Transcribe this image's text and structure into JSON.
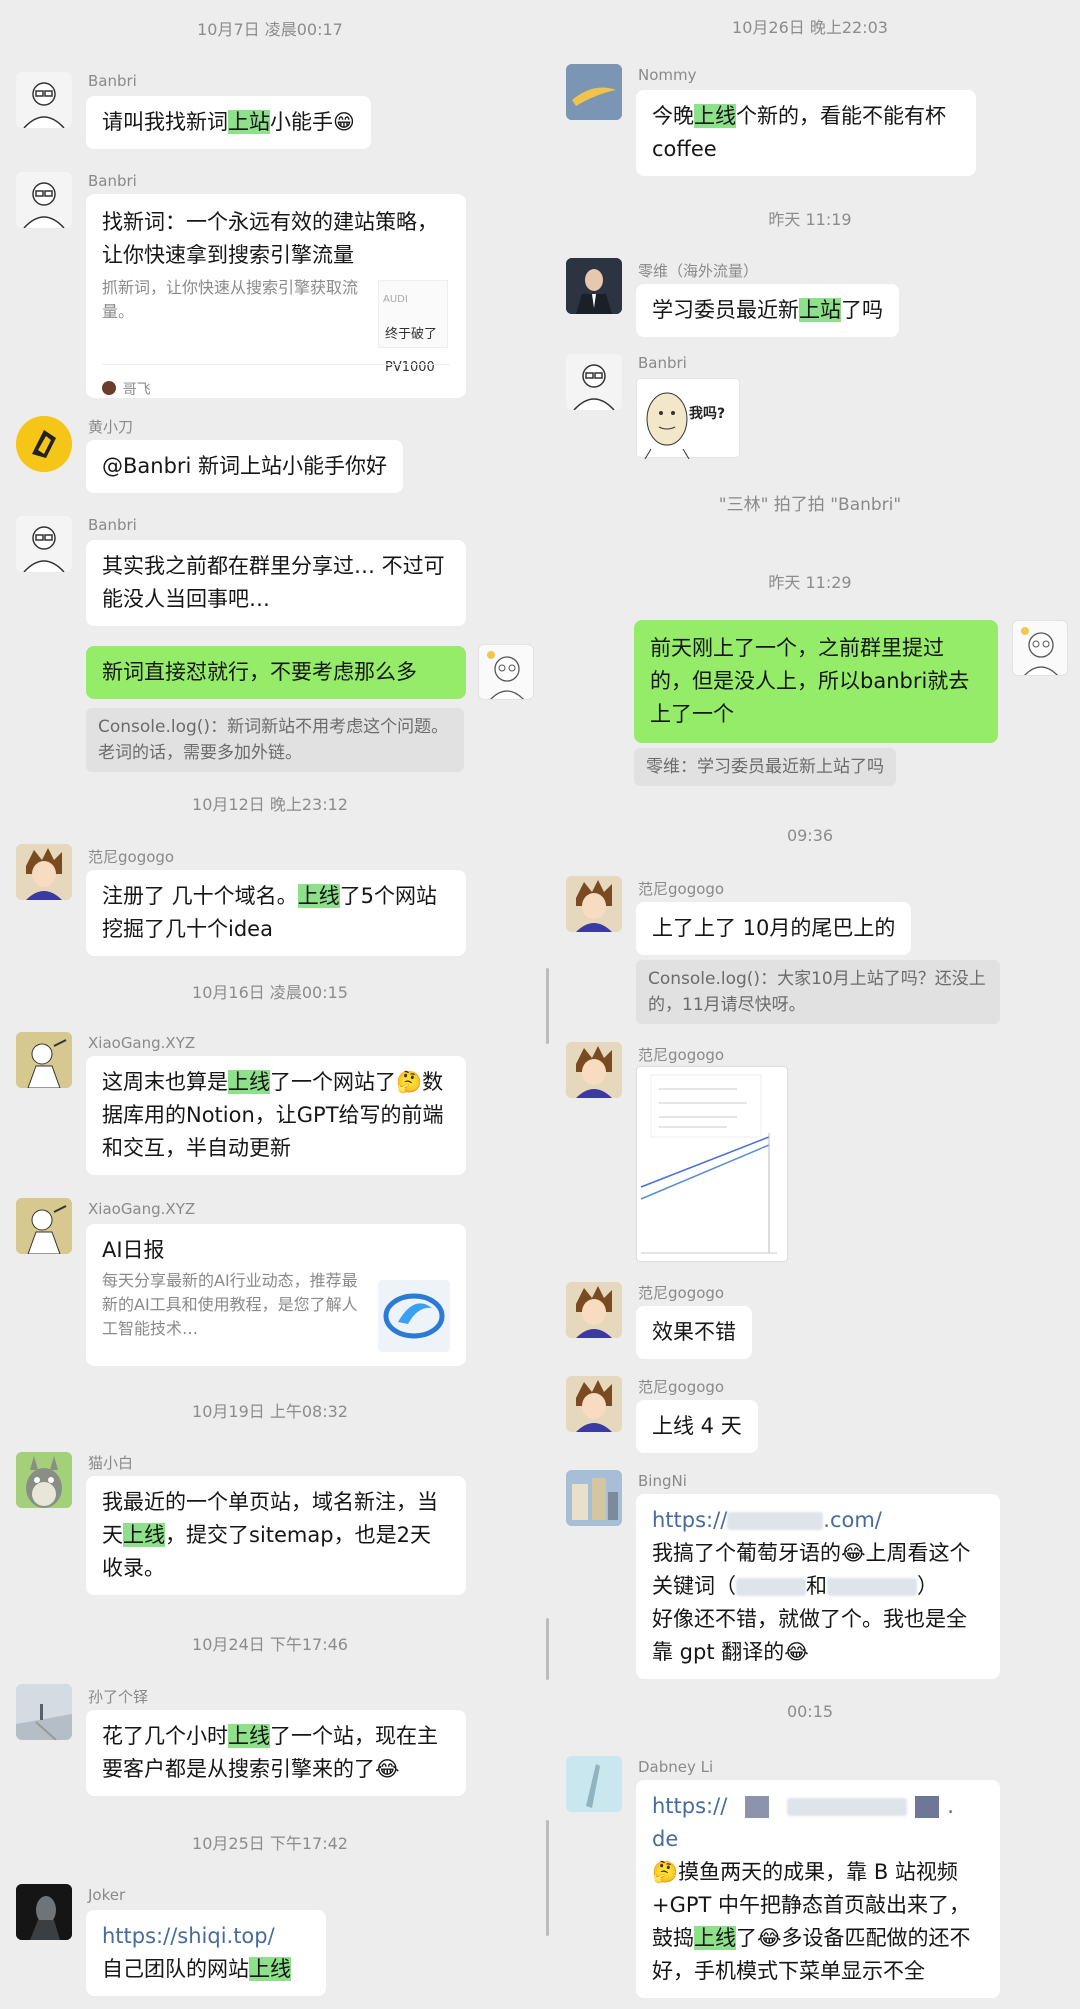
{
  "left": {
    "times": [
      "10月7日 凌晨00:17",
      "10月12日 晚上23:12",
      "10月16日 凌晨00:15",
      "10月19日 上午08:32",
      "10月24日 下午17:46",
      "10月25日 下午17:42"
    ],
    "messages": [
      {
        "nick": "Banbri",
        "pre": "请叫我找新词",
        "hl": "上站",
        "post": "小能手😁"
      },
      {
        "nick": "Banbri",
        "card_title": "找新词：一个永远有效的建站策略，让你快速拿到搜索引擎流量",
        "card_desc": "抓新词，让你快速从搜索引擎获取流量。",
        "thumb_top": "AUDI",
        "thumb_line1": "终于破了",
        "thumb_line2": "PV1000",
        "source": "哥飞"
      },
      {
        "nick": "黄小刀",
        "text": "@Banbri  新词上站小能手你好"
      },
      {
        "nick": "Banbri",
        "text": "其实我之前都在群里分享过… 不过可能没人当回事吧…"
      },
      {
        "text": "新词直接怼就行，不要考虑那么多",
        "quote": "Console.log()：新词新站不用考虑这个问题。 老词的话，需要多加外链。"
      },
      {
        "nick": "范尼gogogo",
        "pre": "注册了 几十个域名。",
        "hl": "上线",
        "post": "了5个网站 挖掘了几十个idea"
      },
      {
        "nick": "XiaoGang.XYZ",
        "pre": "这周末也算是",
        "hl": "上线",
        "post": "了一个网站了🤔数据库用的Notion，让GPT给写的前端和交互，半自动更新"
      },
      {
        "nick": "XiaoGang.XYZ",
        "card_title": "AI日报",
        "card_desc": "每天分享最新的AI行业动态，推荐最新的AI工具和使用教程，是您了解人工智能技术…"
      },
      {
        "nick": "猫小白",
        "pre": "我最近的一个单页站，域名新注，当天",
        "hl": "上线",
        "post": "，提交了sitemap，也是2天收录。"
      },
      {
        "nick": "孙了个铎",
        "pre": "花了几个小时",
        "hl": "上线",
        "post": "了一个站，现在主要客户都是从搜索引擎来的了😂"
      },
      {
        "nick": "Joker",
        "link": "https://shiqi.top/",
        "pre": "自己团队的网站",
        "hl": "上线",
        "post": ""
      }
    ]
  },
  "right": {
    "times": [
      "10月26日 晚上22:03",
      "昨天 11:19",
      "昨天 11:29",
      "09:36",
      "00:15"
    ],
    "system_msg": "\"三林\" 拍了拍 \"Banbri\"",
    "messages": [
      {
        "nick": "Nommy",
        "pre": "今晚",
        "hl": "上线",
        "post": "个新的，看能不能有杯coffee"
      },
      {
        "nick": "零维（海外流量）",
        "pre": "学习委员最近新",
        "hl": "上站",
        "post": "了吗"
      },
      {
        "nick": "Banbri",
        "sticker_text": "我吗?"
      },
      {
        "text": "前天刚上了一个，之前群里提过的，但是没人上，所以banbri就去上了一个",
        "quote": "零维：学习委员最近新上站了吗"
      },
      {
        "nick": "范尼gogogo",
        "text": "上了上了 10月的尾巴上的",
        "quote": "Console.log()：大家10月上站了吗？还没上的，11月请尽快呀。"
      },
      {
        "nick": "范尼gogogo"
      },
      {
        "nick": "范尼gogogo",
        "text": "效果不错"
      },
      {
        "nick": "范尼gogogo",
        "text": "上线 4 天"
      },
      {
        "nick": "BingNi",
        "link_a": "https://",
        "link_b": ".com/",
        "line1": "我搞了个葡萄牙语的😂上周看这个",
        "line2a": "关键词（",
        "line2b": "和",
        "line2c": "）",
        "line3": "好像还不错，就做了个。我也是全靠 gpt 翻译的😂"
      },
      {
        "nick": "Dabney Li",
        "link_a": "https://",
        "link_b": ".",
        "link_c": "de",
        "pre": "🤔摸鱼两天的成果，靠 B 站视频+GPT 中午把静态首页敲出来了，鼓捣",
        "hl": "上线",
        "post": "了😂多设备匹配做的还不好，手机模式下菜单显示不全"
      }
    ]
  },
  "colors": {
    "background": "#ededed",
    "bubble_self": "#95ec69",
    "highlight": "#8ee18a",
    "link": "#466b9c"
  }
}
